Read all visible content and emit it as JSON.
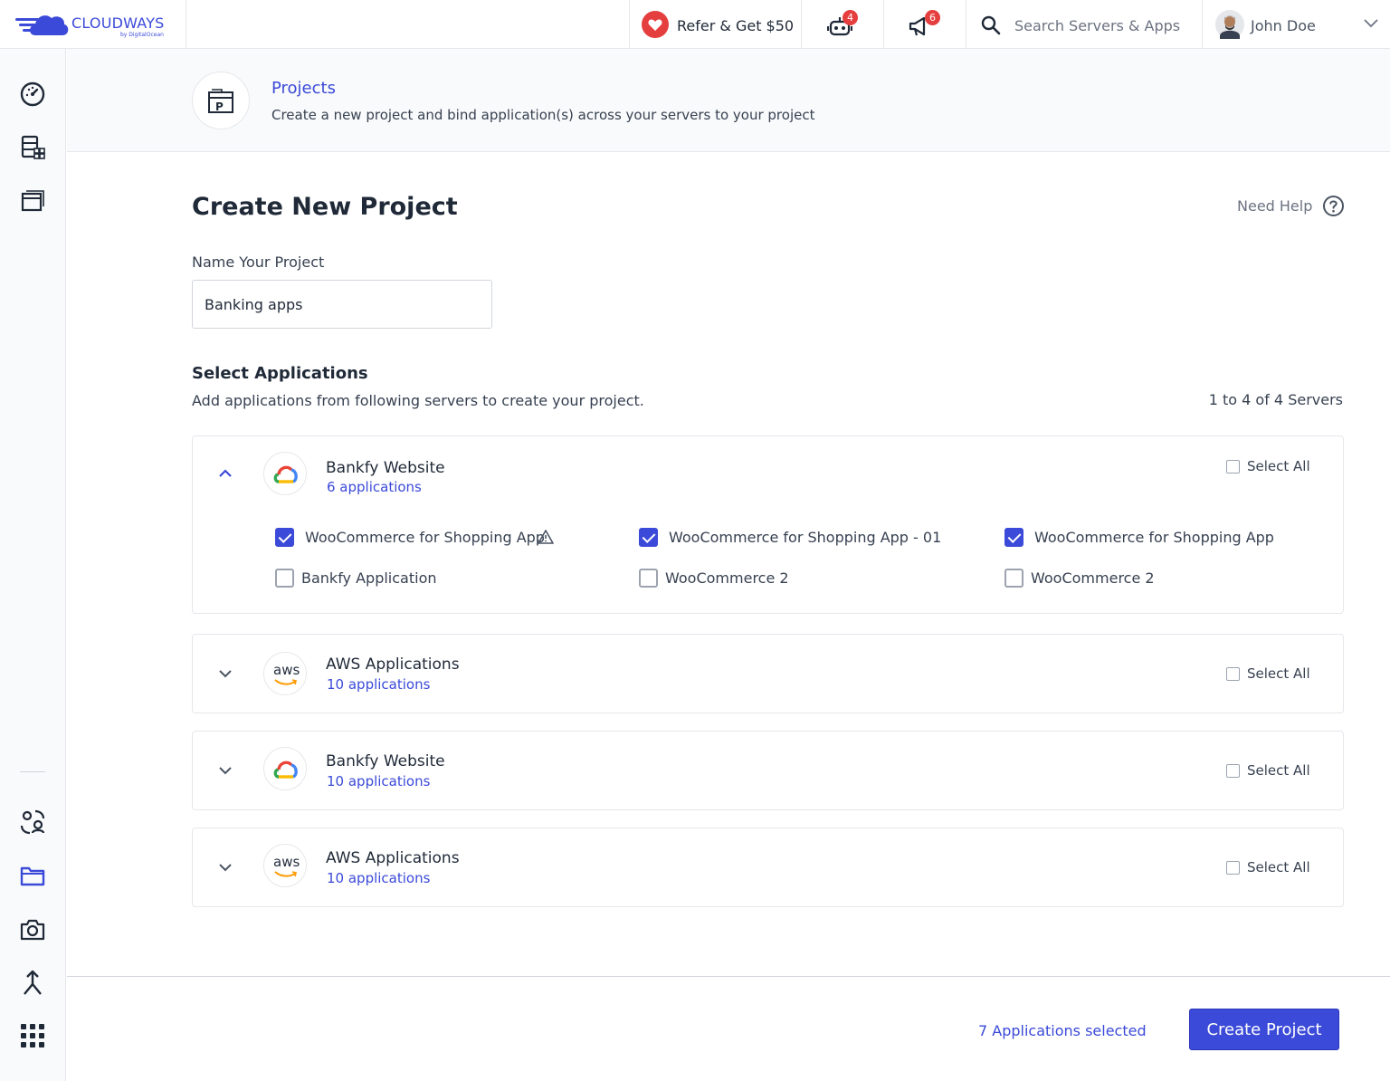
{
  "brand": {
    "name": "CLOUDWAYS",
    "sub": "by DigitalOcean",
    "color": "#3b4ad8"
  },
  "topbar": {
    "refer_label": "Refer & Get $50",
    "bot_badge": "4",
    "announce_badge": "6",
    "search_placeholder": "Search Servers & Apps",
    "user_name": "John Doe"
  },
  "header": {
    "title": "Projects",
    "description": "Create a new project and bind application(s) across your servers to your project"
  },
  "form": {
    "page_title": "Create New Project",
    "need_help": "Need Help",
    "name_label": "Name Your Project",
    "name_value": "Banking apps",
    "select_title": "Select Applications",
    "select_desc": "Add applications from following servers to create your project.",
    "server_count": "1 to 4 of 4 Servers",
    "select_all_label": "Select All"
  },
  "servers": [
    {
      "name": "Bankfy Website",
      "apps_count": "6 applications",
      "provider": "google-cloud",
      "expanded": true,
      "apps": [
        {
          "label": "WooCommerce for Shopping App",
          "checked": true,
          "warning": true
        },
        {
          "label": "WooCommerce for Shopping App - 01",
          "checked": true
        },
        {
          "label": "WooCommerce for Shopping App",
          "checked": true
        },
        {
          "label": "Bankfy Application",
          "checked": false
        },
        {
          "label": "WooCommerce 2",
          "checked": false
        },
        {
          "label": "WooCommerce 2",
          "checked": false
        }
      ]
    },
    {
      "name": "AWS Applications",
      "apps_count": "10 applications",
      "provider": "aws",
      "expanded": false,
      "logo_text": "aws"
    },
    {
      "name": "Bankfy Website",
      "apps_count": "10 applications",
      "provider": "google-cloud",
      "expanded": false
    },
    {
      "name": "AWS Applications",
      "apps_count": "10 applications",
      "provider": "aws",
      "expanded": false,
      "logo_text": "aws"
    }
  ],
  "footer": {
    "selected_count": "7 Applications selected",
    "create_label": "Create Project"
  }
}
